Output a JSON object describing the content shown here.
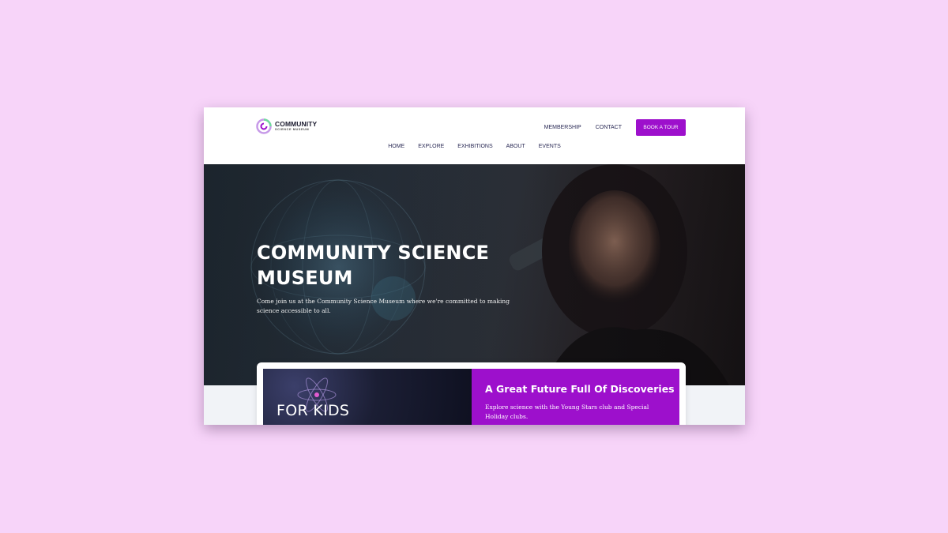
{
  "brand": {
    "name_line1": "COMMUNITY",
    "name_line2": "SCIENCE MUSEUM",
    "accent_color": "#9d10cc",
    "logo_icon": "swirl-logo-icon"
  },
  "header": {
    "top_links": [
      "MEMBERSHIP",
      "CONTACT"
    ],
    "cta_label": "BOOK A TOUR",
    "nav": [
      "HOME",
      "EXPLORE",
      "EXHIBITIONS",
      "ABOUT",
      "EVENTS"
    ]
  },
  "hero": {
    "title": "COMMUNITY SCIENCE MUSEUM",
    "subtitle": "Come join us at the Community Science Museum where we're committed to making science accessible to all."
  },
  "feature": {
    "kids_label": "FOR KIDS",
    "promo_title": "A Great Future Full Of Discoveries",
    "promo_text": "Explore science with the Young Stars club and Special Holiday clubs."
  },
  "colors": {
    "page_background": "#f7d4f9",
    "nav_text": "#2a2a55",
    "band_background": "#f1f3f7"
  }
}
